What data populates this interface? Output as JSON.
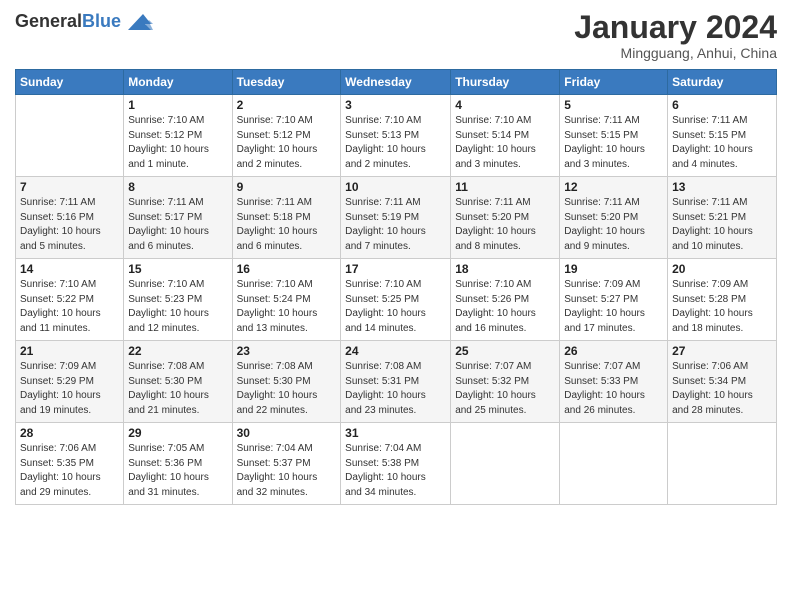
{
  "logo": {
    "general": "General",
    "blue": "Blue"
  },
  "header": {
    "month": "January 2024",
    "location": "Mingguang, Anhui, China"
  },
  "columns": [
    "Sunday",
    "Monday",
    "Tuesday",
    "Wednesday",
    "Thursday",
    "Friday",
    "Saturday"
  ],
  "weeks": [
    [
      {
        "day": "",
        "info": ""
      },
      {
        "day": "1",
        "info": "Sunrise: 7:10 AM\nSunset: 5:12 PM\nDaylight: 10 hours\nand 1 minute."
      },
      {
        "day": "2",
        "info": "Sunrise: 7:10 AM\nSunset: 5:12 PM\nDaylight: 10 hours\nand 2 minutes."
      },
      {
        "day": "3",
        "info": "Sunrise: 7:10 AM\nSunset: 5:13 PM\nDaylight: 10 hours\nand 2 minutes."
      },
      {
        "day": "4",
        "info": "Sunrise: 7:10 AM\nSunset: 5:14 PM\nDaylight: 10 hours\nand 3 minutes."
      },
      {
        "day": "5",
        "info": "Sunrise: 7:11 AM\nSunset: 5:15 PM\nDaylight: 10 hours\nand 3 minutes."
      },
      {
        "day": "6",
        "info": "Sunrise: 7:11 AM\nSunset: 5:15 PM\nDaylight: 10 hours\nand 4 minutes."
      }
    ],
    [
      {
        "day": "7",
        "info": "Sunrise: 7:11 AM\nSunset: 5:16 PM\nDaylight: 10 hours\nand 5 minutes."
      },
      {
        "day": "8",
        "info": "Sunrise: 7:11 AM\nSunset: 5:17 PM\nDaylight: 10 hours\nand 6 minutes."
      },
      {
        "day": "9",
        "info": "Sunrise: 7:11 AM\nSunset: 5:18 PM\nDaylight: 10 hours\nand 6 minutes."
      },
      {
        "day": "10",
        "info": "Sunrise: 7:11 AM\nSunset: 5:19 PM\nDaylight: 10 hours\nand 7 minutes."
      },
      {
        "day": "11",
        "info": "Sunrise: 7:11 AM\nSunset: 5:20 PM\nDaylight: 10 hours\nand 8 minutes."
      },
      {
        "day": "12",
        "info": "Sunrise: 7:11 AM\nSunset: 5:20 PM\nDaylight: 10 hours\nand 9 minutes."
      },
      {
        "day": "13",
        "info": "Sunrise: 7:11 AM\nSunset: 5:21 PM\nDaylight: 10 hours\nand 10 minutes."
      }
    ],
    [
      {
        "day": "14",
        "info": "Sunrise: 7:10 AM\nSunset: 5:22 PM\nDaylight: 10 hours\nand 11 minutes."
      },
      {
        "day": "15",
        "info": "Sunrise: 7:10 AM\nSunset: 5:23 PM\nDaylight: 10 hours\nand 12 minutes."
      },
      {
        "day": "16",
        "info": "Sunrise: 7:10 AM\nSunset: 5:24 PM\nDaylight: 10 hours\nand 13 minutes."
      },
      {
        "day": "17",
        "info": "Sunrise: 7:10 AM\nSunset: 5:25 PM\nDaylight: 10 hours\nand 14 minutes."
      },
      {
        "day": "18",
        "info": "Sunrise: 7:10 AM\nSunset: 5:26 PM\nDaylight: 10 hours\nand 16 minutes."
      },
      {
        "day": "19",
        "info": "Sunrise: 7:09 AM\nSunset: 5:27 PM\nDaylight: 10 hours\nand 17 minutes."
      },
      {
        "day": "20",
        "info": "Sunrise: 7:09 AM\nSunset: 5:28 PM\nDaylight: 10 hours\nand 18 minutes."
      }
    ],
    [
      {
        "day": "21",
        "info": "Sunrise: 7:09 AM\nSunset: 5:29 PM\nDaylight: 10 hours\nand 19 minutes."
      },
      {
        "day": "22",
        "info": "Sunrise: 7:08 AM\nSunset: 5:30 PM\nDaylight: 10 hours\nand 21 minutes."
      },
      {
        "day": "23",
        "info": "Sunrise: 7:08 AM\nSunset: 5:30 PM\nDaylight: 10 hours\nand 22 minutes."
      },
      {
        "day": "24",
        "info": "Sunrise: 7:08 AM\nSunset: 5:31 PM\nDaylight: 10 hours\nand 23 minutes."
      },
      {
        "day": "25",
        "info": "Sunrise: 7:07 AM\nSunset: 5:32 PM\nDaylight: 10 hours\nand 25 minutes."
      },
      {
        "day": "26",
        "info": "Sunrise: 7:07 AM\nSunset: 5:33 PM\nDaylight: 10 hours\nand 26 minutes."
      },
      {
        "day": "27",
        "info": "Sunrise: 7:06 AM\nSunset: 5:34 PM\nDaylight: 10 hours\nand 28 minutes."
      }
    ],
    [
      {
        "day": "28",
        "info": "Sunrise: 7:06 AM\nSunset: 5:35 PM\nDaylight: 10 hours\nand 29 minutes."
      },
      {
        "day": "29",
        "info": "Sunrise: 7:05 AM\nSunset: 5:36 PM\nDaylight: 10 hours\nand 31 minutes."
      },
      {
        "day": "30",
        "info": "Sunrise: 7:04 AM\nSunset: 5:37 PM\nDaylight: 10 hours\nand 32 minutes."
      },
      {
        "day": "31",
        "info": "Sunrise: 7:04 AM\nSunset: 5:38 PM\nDaylight: 10 hours\nand 34 minutes."
      },
      {
        "day": "",
        "info": ""
      },
      {
        "day": "",
        "info": ""
      },
      {
        "day": "",
        "info": ""
      }
    ]
  ]
}
